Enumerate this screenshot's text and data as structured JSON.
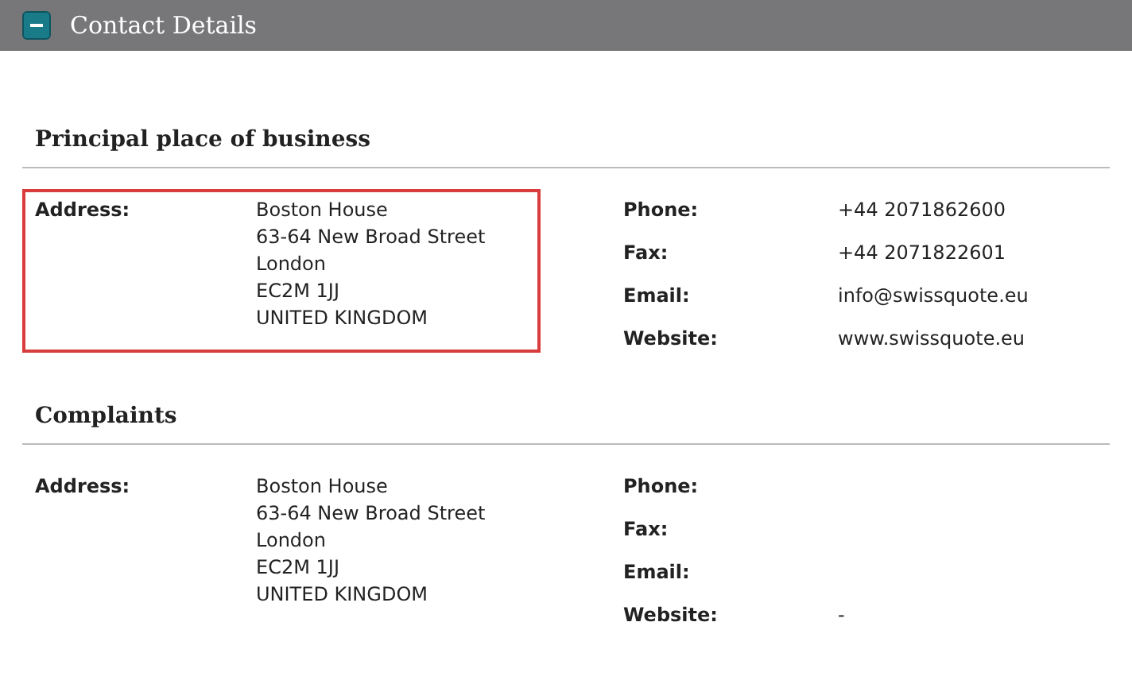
{
  "panel": {
    "title": "Contact Details",
    "expanded": true
  },
  "sections": [
    {
      "title": "Principal place of business",
      "highlighted": true,
      "address": {
        "label": "Address:",
        "lines": [
          "Boston House",
          "63-64 New Broad Street",
          "London",
          "EC2M 1JJ",
          "UNITED KINGDOM"
        ]
      },
      "contacts": [
        {
          "label": "Phone:",
          "value": "+44 2071862600"
        },
        {
          "label": "Fax:",
          "value": "+44 2071822601"
        },
        {
          "label": "Email:",
          "value": "info@swissquote.eu"
        },
        {
          "label": "Website:",
          "value": "www.swissquote.eu"
        }
      ]
    },
    {
      "title": "Complaints",
      "highlighted": false,
      "address": {
        "label": "Address:",
        "lines": [
          "Boston House",
          "63-64 New Broad Street",
          "London",
          "EC2M 1JJ",
          "UNITED KINGDOM"
        ]
      },
      "contacts": [
        {
          "label": "Phone:"
        },
        {
          "label": "Fax:"
        },
        {
          "label": "Email:"
        },
        {
          "label": "Website:",
          "value": "-"
        }
      ]
    }
  ]
}
